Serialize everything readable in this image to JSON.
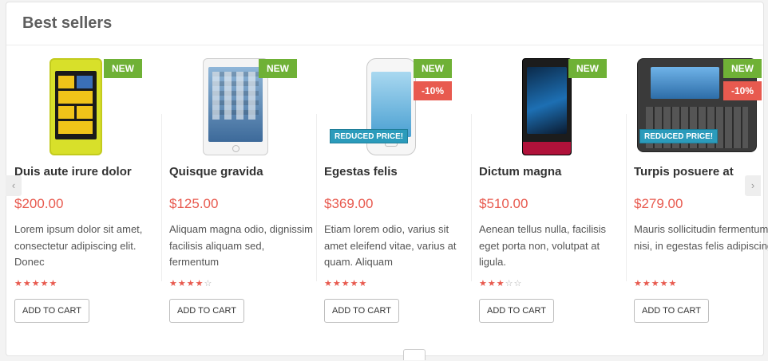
{
  "panel": {
    "title": "Best sellers"
  },
  "carousel": {
    "prev_label": "‹",
    "next_label": "›"
  },
  "products": [
    {
      "name": "Duis aute irure dolor",
      "price": "$200.00",
      "description": "Lorem ipsum dolor sit amet, consectetur adipiscing elit. Donec",
      "rating": 5,
      "badge_new": "NEW",
      "badge_discount": "",
      "badge_reduced": "",
      "button": "ADD TO CART",
      "stars_text": "★★★★★",
      "stars_off": ""
    },
    {
      "name": "Quisque gravida",
      "price": "$125.00",
      "description": "Aliquam magna odio, dignissim facilisis aliquam sed, fermentum",
      "rating": 4,
      "badge_new": "NEW",
      "badge_discount": "",
      "badge_reduced": "",
      "button": "ADD TO CART",
      "stars_text": "★★★★",
      "stars_off": "☆"
    },
    {
      "name": "Egestas felis",
      "price": "$369.00",
      "description": "Etiam lorem odio, varius sit amet eleifend vitae, varius at quam. Aliquam",
      "rating": 5,
      "badge_new": "NEW",
      "badge_discount": "-10%",
      "badge_reduced": "REDUCED PRICE!",
      "button": "ADD TO CART",
      "stars_text": "★★★★★",
      "stars_off": ""
    },
    {
      "name": "Dictum magna",
      "price": "$510.00",
      "description": "Aenean tellus nulla, facilisis eget porta non, volutpat at ligula.",
      "rating": 3,
      "badge_new": "NEW",
      "badge_discount": "",
      "badge_reduced": "",
      "button": "ADD TO CART",
      "stars_text": "★★★",
      "stars_off": "☆☆"
    },
    {
      "name": "Turpis posuere at",
      "price": "$279.00",
      "description": "Mauris sollicitudin fermentum nisi, in egestas felis adipiscing",
      "rating": 5,
      "badge_new": "NEW",
      "badge_discount": "-10%",
      "badge_reduced": "REDUCED PRICE!",
      "button": "ADD TO CART",
      "stars_text": "★★★★★",
      "stars_off": ""
    }
  ],
  "colors": {
    "accent_price": "#e85a4f",
    "badge_new": "#6fb136",
    "badge_discount": "#e85a4f",
    "badge_reduced": "#2b9bbb"
  }
}
